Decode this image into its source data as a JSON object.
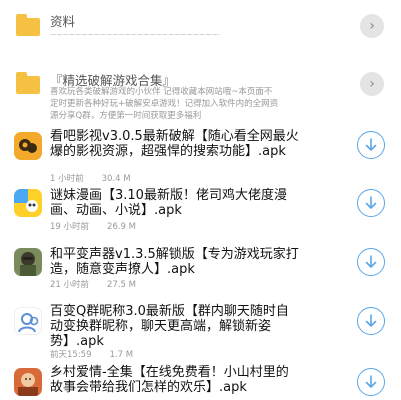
{
  "folders": [
    {
      "title": "资料",
      "squiggle": "~~~~~~~~~~~~~~~~~~~~~~~~~~~~~~~~~~~~~~~~~~~"
    },
    {
      "title": "『精选破解游戏合集』",
      "desc": "喜欢玩各类破解游戏的小伙伴 记得收藏本网站哦~本页面不定时更新各种好玩+破解安卓游戏！记得加入软件内的全网资源分享Q群，方便第一时间获取更多福利"
    }
  ],
  "files": [
    {
      "name": "看吧影视v3.0.5最新破解【随心看全网最火爆的影视资源，超强悍的搜索功能】.apk",
      "time": "1 小时前",
      "size": "30.4 M"
    },
    {
      "name": "谜妹漫画【3.10最新版！佬司鸡大佬度漫画、动画、小说】.apk",
      "time": "19 小时前",
      "size": "26.9 M"
    },
    {
      "name": "和平变声器v1.3.5解锁版【专为游戏玩家打造，随意变声撩人】.apk",
      "time": "21 小时前",
      "size": "27.5 M"
    },
    {
      "name": "百变Q群昵称3.0最新版【群内聊天随时自动变换群昵称，聊天更高端，解锁新姿势】.apk",
      "time": "前天15:59",
      "size": "1.7 M"
    },
    {
      "name": "乡村爱情-全集【在线免费看！小山村里的故事会带给我们怎样的欢乐】.apk",
      "time": "",
      "size": ""
    }
  ],
  "colors": {
    "folder": "#f6c142",
    "download": "#5ba7e8",
    "chevron_bg": "#e4e4e4"
  }
}
